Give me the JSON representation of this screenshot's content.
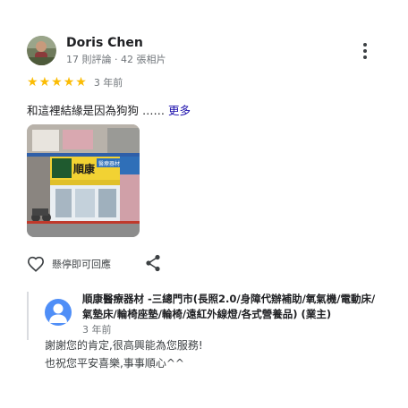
{
  "review": {
    "author_name": "Doris Chen",
    "author_meta": "17 則評論 · 42 張相片",
    "rating": 5,
    "time": "3 年前",
    "text": "和這裡結緣是因為狗狗 …… ",
    "more_label": "更多",
    "like_label": "懸停即可回應"
  },
  "photo": {
    "sign_brand": "順康",
    "sign_right": "醫療器材"
  },
  "owner_response": {
    "name": "順康醫療器材 -三總門市(長照2.0/身障代辦補助/氧氣機/電動床/氣墊床/輪椅座墊/輪椅/遠紅外線燈/各式營養品) (業主)",
    "time": "3 年前",
    "line1": "謝謝您的肯定,很高興能為您服務!",
    "line2": "也祝您平安喜樂,事事順心^^"
  },
  "colors": {
    "star": "#fbbc04",
    "link": "#1a0dab",
    "owner_avatar": "#4f8ef7",
    "muted_text": "#70757a"
  },
  "icons": {
    "more": "more-vert-icon",
    "like": "heart-outline-icon",
    "share": "share-icon",
    "star": "star-icon",
    "owner_avatar": "person-icon"
  }
}
